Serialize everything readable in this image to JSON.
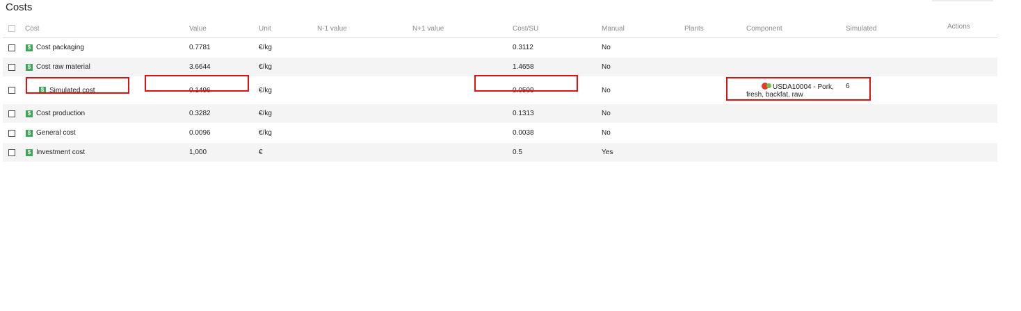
{
  "page": {
    "title": "Costs"
  },
  "table": {
    "columns": {
      "cost": "Cost",
      "value": "Value",
      "unit": "Unit",
      "n_minus_1": "N-1 value",
      "n_plus_1": "N+1 value",
      "cost_su": "Cost/SU",
      "manual": "Manual",
      "plants": "Plants",
      "component": "Component",
      "simulated": "Simulated",
      "actions": "Actions"
    },
    "rows": [
      {
        "name": "Cost packaging",
        "value": "0.7781",
        "unit": "€/kg",
        "cost_su": "0.3112",
        "manual": "No"
      },
      {
        "name": "Cost raw material",
        "value": "3.6644",
        "unit": "€/kg",
        "cost_su": "1.4658",
        "manual": "No"
      },
      {
        "name": "Simulated cost",
        "value": "0.1496",
        "unit": "€/kg",
        "cost_su": "0.0599",
        "manual": "No",
        "component": "USDA10004 - Pork, fresh, backfat, raw",
        "simulated": "6"
      },
      {
        "name": "Cost production",
        "value": "0.3282",
        "unit": "€/kg",
        "cost_su": "0.1313",
        "manual": "No"
      },
      {
        "name": "General cost",
        "value": "0.0096",
        "unit": "€/kg",
        "cost_su": "0.0038",
        "manual": "No"
      },
      {
        "name": "Investment cost",
        "value": "1,000",
        "unit": "€",
        "cost_su": "0.5",
        "manual": "Yes"
      }
    ]
  },
  "icons": {
    "cost_type": "dollar-icon",
    "component": "tomato-icon",
    "dollar_glyph": "$"
  },
  "colors": {
    "highlight": "#e01010",
    "cost_icon": "#3aa757",
    "row_alt": "#f4f4f4"
  }
}
